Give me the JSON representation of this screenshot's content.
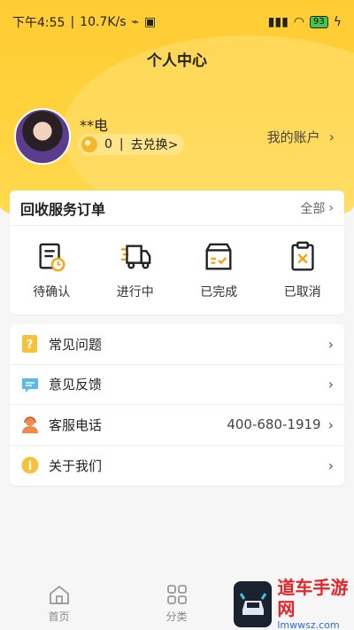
{
  "status_bar": {
    "time": "下午4:55",
    "speed": "10.7K/s",
    "battery": "93"
  },
  "header": {
    "title": "个人中心"
  },
  "profile": {
    "username": "**电",
    "points": "0",
    "points_separator": "|",
    "exchange_label": "去兑换>",
    "account_label": "我的账户"
  },
  "orders": {
    "title": "回收服务订单",
    "all_label": "全部",
    "tabs": [
      {
        "label": "待确认",
        "icon": "pending-clipboard-icon"
      },
      {
        "label": "进行中",
        "icon": "delivery-truck-icon"
      },
      {
        "label": "已完成",
        "icon": "completed-box-icon"
      },
      {
        "label": "已取消",
        "icon": "cancelled-clipboard-icon"
      }
    ]
  },
  "menu": {
    "items": [
      {
        "label": "常见问题",
        "value": "",
        "icon": "faq-icon"
      },
      {
        "label": "意见反馈",
        "value": "",
        "icon": "feedback-icon"
      },
      {
        "label": "客服电话",
        "value": "400-680-1919",
        "icon": "customer-service-icon"
      },
      {
        "label": "关于我们",
        "value": "",
        "icon": "info-icon"
      }
    ]
  },
  "bottom_nav": {
    "items": [
      {
        "label": "首页",
        "icon": "home-icon"
      },
      {
        "label": "分类",
        "icon": "category-grid-icon"
      }
    ]
  },
  "watermark": {
    "title": "道车手游网",
    "url": "lmwwsz.com"
  },
  "colors": {
    "brand_yellow": "#ffcc33",
    "accent_orange": "#f4a316",
    "text_dark": "#222222"
  }
}
